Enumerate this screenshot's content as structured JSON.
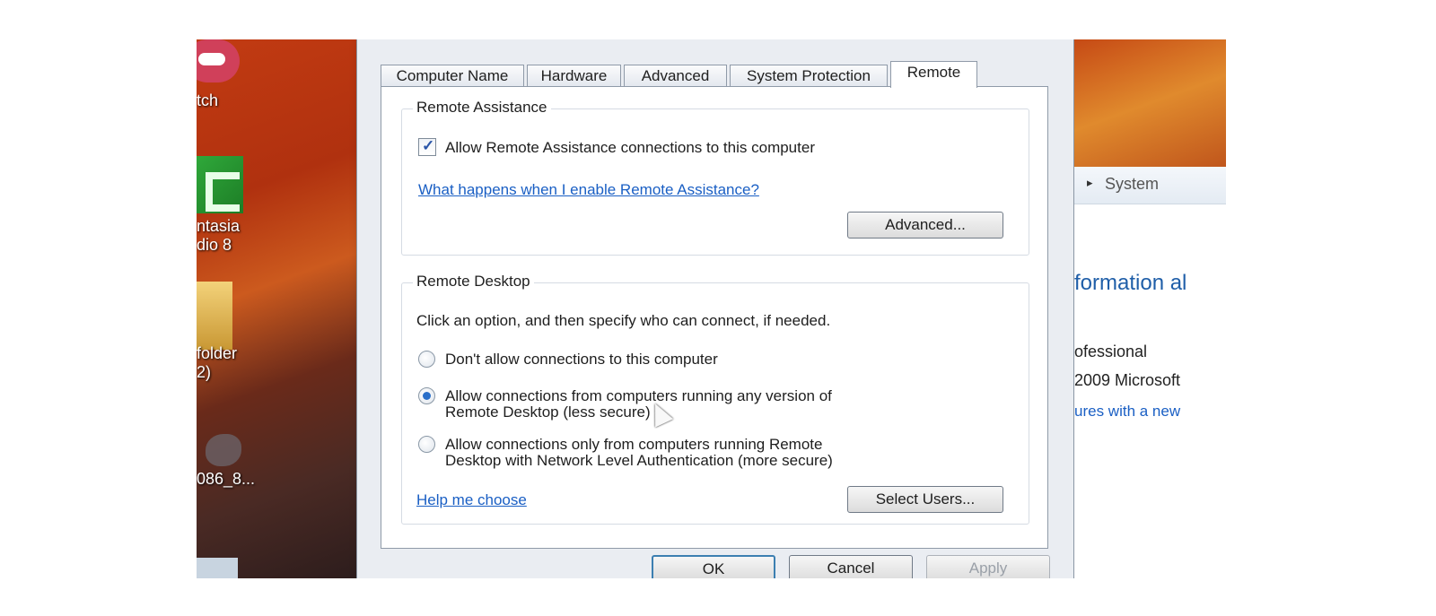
{
  "desktop": {
    "icons": [
      {
        "label": "tch"
      },
      {
        "label": "ntasia\ndio 8"
      },
      {
        "label": "folder\n2)"
      },
      {
        "label": "086_8..."
      }
    ]
  },
  "dialog": {
    "tabs": [
      "Computer Name",
      "Hardware",
      "Advanced",
      "System Protection",
      "Remote"
    ],
    "active_tab": "Remote",
    "remote_assistance": {
      "legend": "Remote Assistance",
      "checkbox_label": "Allow Remote Assistance connections to this computer",
      "checked": true,
      "help_link": "What happens when I enable Remote Assistance?",
      "advanced_button": "Advanced..."
    },
    "remote_desktop": {
      "legend": "Remote Desktop",
      "instruction": "Click an option, and then specify who can connect, if needed.",
      "options": [
        {
          "line1": "Don't allow connections to this computer",
          "line2": "",
          "selected": false
        },
        {
          "line1": "Allow connections from computers running any version of",
          "line2": "Remote Desktop (less secure)",
          "selected": true
        },
        {
          "line1": "Allow connections only from computers running Remote",
          "line2": "Desktop with Network Level Authentication (more secure)",
          "selected": false
        }
      ],
      "help_link": "Help me choose",
      "select_users_button": "Select Users..."
    },
    "footer": {
      "ok": "OK",
      "cancel": "Cancel",
      "apply": "Apply"
    }
  },
  "background_window": {
    "breadcrumb_arrow": "▸",
    "breadcrumb": "System",
    "heading": "formation al",
    "edition": "ofessional",
    "copyright": "2009 Microsoft",
    "link": "ures with a new"
  }
}
